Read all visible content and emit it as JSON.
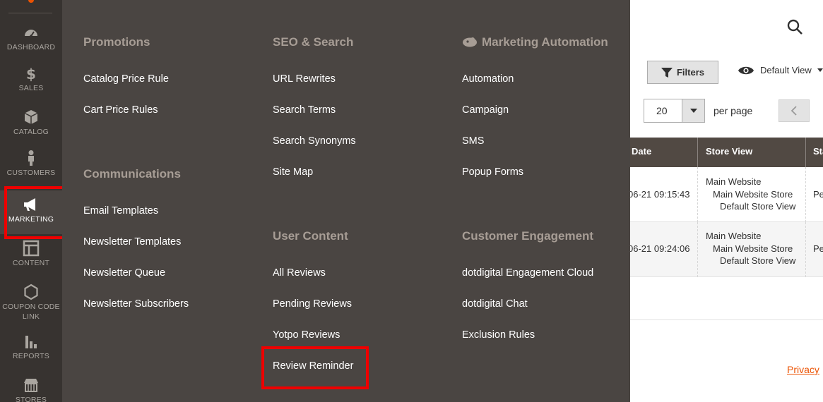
{
  "sidebar": {
    "items": [
      {
        "label": "DASHBOARD",
        "icon": "dashboard-icon"
      },
      {
        "label": "SALES",
        "icon": "dollar-icon"
      },
      {
        "label": "CATALOG",
        "icon": "box-icon"
      },
      {
        "label": "CUSTOMERS",
        "icon": "person-icon"
      },
      {
        "label": "MARKETING",
        "icon": "megaphone-icon"
      },
      {
        "label": "CONTENT",
        "icon": "layout-icon"
      },
      {
        "label": "COUPON CODE",
        "label2": "LINK",
        "icon": "hexagon-icon"
      },
      {
        "label": "REPORTS",
        "icon": "bar-chart-icon"
      },
      {
        "label": "STORES",
        "icon": "store-icon"
      }
    ]
  },
  "menu": {
    "promotions": {
      "title": "Promotions",
      "links": [
        "Catalog Price Rule",
        "Cart Price Rules"
      ]
    },
    "communications": {
      "title": "Communications",
      "links": [
        "Email Templates",
        "Newsletter Templates",
        "Newsletter Queue",
        "Newsletter Subscribers"
      ]
    },
    "seo": {
      "title": "SEO & Search",
      "links": [
        "URL Rewrites",
        "Search Terms",
        "Search Synonyms",
        "Site Map"
      ]
    },
    "user_content": {
      "title": "User Content",
      "links": [
        "All Reviews",
        "Pending Reviews",
        "Yotpo Reviews",
        "Review Reminder"
      ]
    },
    "automation": {
      "title": "Marketing Automation",
      "links": [
        "Automation",
        "Campaign",
        "SMS",
        "Popup Forms"
      ]
    },
    "engagement": {
      "title": "Customer Engagement",
      "links": [
        "dotdigital Engagement Cloud",
        "dotdigital Chat",
        "Exclusion Rules"
      ]
    }
  },
  "page": {
    "filters_label": "Filters",
    "view_label": "Default View",
    "per_page_value": "20",
    "per_page_label": "per page",
    "columns": [
      "Date",
      "Store View",
      "Sta"
    ],
    "rows": [
      {
        "date": "06-21 09:15:43",
        "store": [
          "Main Website",
          "Main Website Store",
          "Default Store View"
        ],
        "status": "Pe"
      },
      {
        "date": "06-21 09:24:06",
        "store": [
          "Main Website",
          "Main Website Store",
          "Default Store View"
        ],
        "status": "Pe"
      }
    ],
    "privacy_label": "Privacy"
  },
  "colors": {
    "accent": "#eb5202",
    "highlight": "#ee0000",
    "nav_bg": "#373330",
    "menu_bg": "#4a4542"
  }
}
